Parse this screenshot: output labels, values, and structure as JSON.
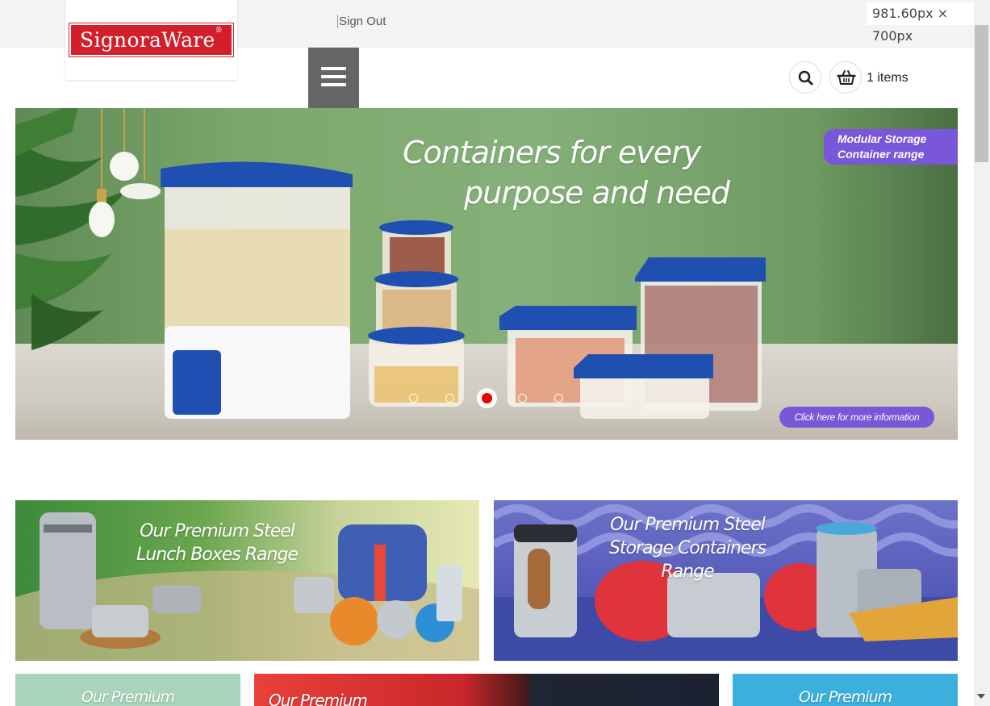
{
  "header": {
    "brand": "SignoraWare",
    "brand_mark": "®",
    "sign_out": "Sign Out",
    "cart_count": "1 items",
    "viewport_readout": "981.60px × 700px"
  },
  "icons": {
    "menu": "hamburger-icon",
    "search": "search-icon",
    "cart": "basket-icon"
  },
  "hero": {
    "headline_line1": "Containers for every",
    "headline_line2": "purpose and need",
    "tag": "Modular Storage Container range",
    "tag_line1": "Modular Storage",
    "tag_line2": "Container range",
    "cta": "Click here for more information",
    "slide_count": 5,
    "active_slide": 3
  },
  "promos": [
    {
      "line1": "Our Premium Steel",
      "line2": "Lunch Boxes Range"
    },
    {
      "line1": "Our Premium Steel",
      "line2": "Storage Containers Range"
    },
    {
      "line1": "Our Premium"
    },
    {
      "line1": "Our Premium"
    },
    {
      "line1": "Our Premium"
    }
  ],
  "colors": {
    "brand_red": "#d31f2b",
    "accent_purple": "#7a56d8",
    "menu_gray": "#666666",
    "active_dot": "#ee0000"
  }
}
